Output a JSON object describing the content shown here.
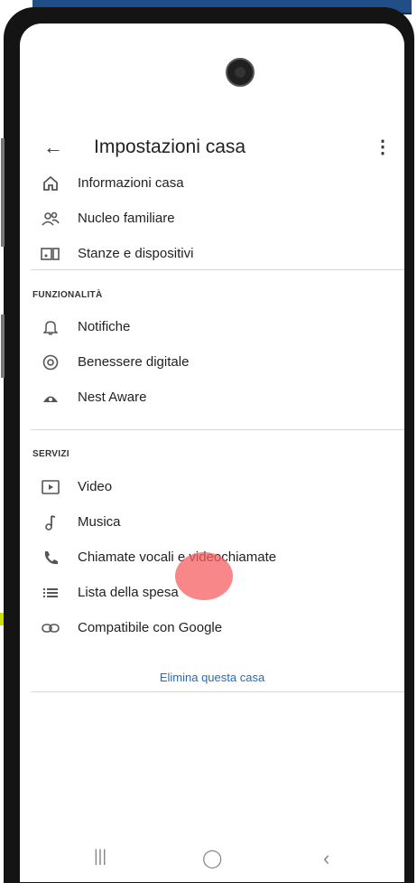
{
  "header": {
    "title": "Impostazioni casa"
  },
  "main_items": [
    {
      "label": "Informazioni casa",
      "icon": "home-icon"
    },
    {
      "label": "Nucleo familiare",
      "icon": "people-icon"
    },
    {
      "label": "Stanze e dispositivi",
      "icon": "devices-icon"
    }
  ],
  "features": {
    "heading": "FUNZIONALITÀ",
    "items": [
      {
        "label": "Notifiche",
        "icon": "bell-icon"
      },
      {
        "label": "Benessere digitale",
        "icon": "wellbeing-icon"
      },
      {
        "label": "Nest Aware",
        "icon": "nest-icon"
      }
    ]
  },
  "services": {
    "heading": "SERVIZI",
    "items": [
      {
        "label": "Video",
        "icon": "video-icon"
      },
      {
        "label": "Musica",
        "icon": "music-icon"
      },
      {
        "label": "Chiamate vocali e videochiamate",
        "icon": "phone-icon"
      },
      {
        "label": "Lista della spesa",
        "icon": "list-icon"
      },
      {
        "label": "Compatibile con Google",
        "icon": "link-icon"
      }
    ]
  },
  "actions": {
    "delete_home": "Elimina questa casa"
  },
  "colors": {
    "accent": "#2a6ab5",
    "touch_indicator": "#f65f62"
  }
}
